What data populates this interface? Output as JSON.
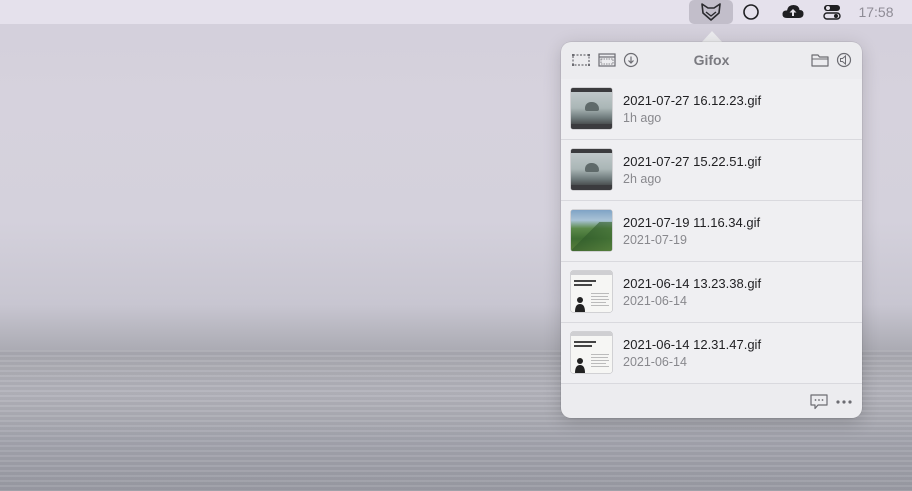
{
  "menubar": {
    "clock": "17:58",
    "icons": [
      "gifox-fox-icon",
      "circle-icon",
      "cloud-upload-icon",
      "control-center-icon"
    ]
  },
  "popover": {
    "title": "Gifox",
    "header_icons": [
      "capture-rectangle-icon",
      "capture-window-icon",
      "download-icon",
      "folder-icon",
      "sound-icon"
    ],
    "items": [
      {
        "filename": "2021-07-27 16.12.23.gif",
        "date": "1h ago",
        "thumb": "mist"
      },
      {
        "filename": "2021-07-27 15.22.51.gif",
        "date": "2h ago",
        "thumb": "mist"
      },
      {
        "filename": "2021-07-19 11.16.34.gif",
        "date": "2021-07-19",
        "thumb": "mountain"
      },
      {
        "filename": "2021-06-14 13.23.38.gif",
        "date": "2021-06-14",
        "thumb": "document"
      },
      {
        "filename": "2021-06-14 12.31.47.gif",
        "date": "2021-06-14",
        "thumb": "document"
      }
    ],
    "footer_icons": [
      "feedback-icon",
      "more-icon"
    ]
  },
  "colors": {
    "popover_bg": "#ececef",
    "title_gray": "#7a7a80"
  }
}
